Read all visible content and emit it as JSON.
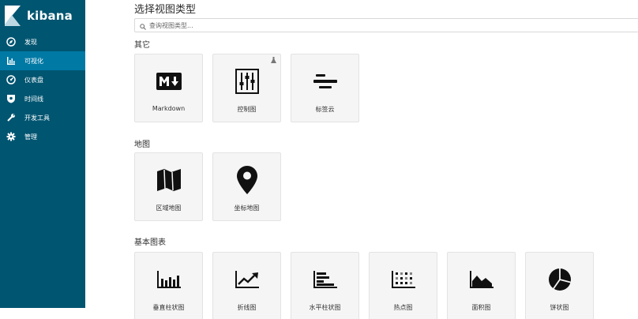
{
  "brand": {
    "name": "kibana"
  },
  "nav": [
    {
      "label": "发现",
      "icon": "compass-icon",
      "active": false
    },
    {
      "label": "可视化",
      "icon": "bar-chart-icon",
      "active": true
    },
    {
      "label": "仪表盘",
      "icon": "gauge-icon",
      "active": false
    },
    {
      "label": "时间线",
      "icon": "shield-icon",
      "active": false
    },
    {
      "label": "开发工具",
      "icon": "wrench-icon",
      "active": false
    },
    {
      "label": "管理",
      "icon": "gear-icon",
      "active": false
    }
  ],
  "page": {
    "title": "选择视图类型",
    "search_placeholder": "查询视图类型..."
  },
  "sections": {
    "other": {
      "title": "其它",
      "cards": [
        {
          "label": "Markdown",
          "icon": "markdown-icon"
        },
        {
          "label": "控制图",
          "icon": "controls-icon",
          "badge": "flask-icon"
        },
        {
          "label": "标签云",
          "icon": "tag-cloud-icon"
        }
      ]
    },
    "maps": {
      "title": "地图",
      "cards": [
        {
          "label": "区域地图",
          "icon": "region-map-icon"
        },
        {
          "label": "坐标地图",
          "icon": "map-pin-icon"
        }
      ]
    },
    "basic": {
      "title": "基本图表",
      "cards": [
        {
          "label": "垂直柱状图",
          "icon": "vertical-bar-icon"
        },
        {
          "label": "折线图",
          "icon": "line-chart-icon"
        },
        {
          "label": "水平柱状图",
          "icon": "horizontal-bar-icon"
        },
        {
          "label": "热点图",
          "icon": "heatmap-icon"
        },
        {
          "label": "面积图",
          "icon": "area-chart-icon"
        },
        {
          "label": "饼状图",
          "icon": "pie-chart-icon"
        }
      ]
    }
  }
}
